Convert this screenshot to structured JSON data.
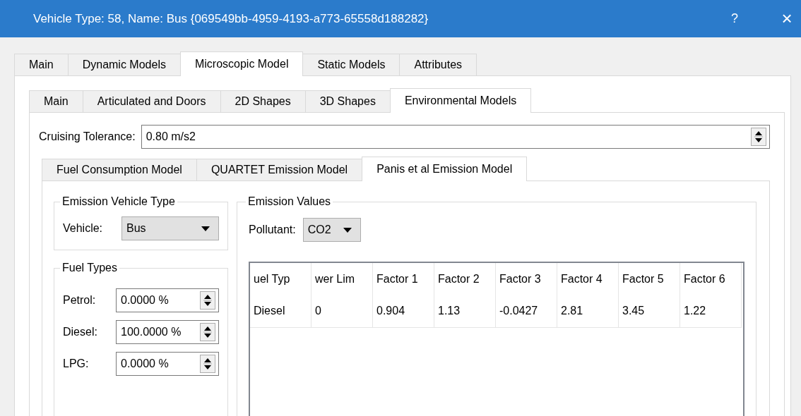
{
  "window": {
    "title": "Vehicle Type: 58, Name: Bus {069549bb-4959-4193-a773-65558d188282}",
    "help_button": "?",
    "close_button": "×"
  },
  "tabs": [
    {
      "label": "Main",
      "selected": false
    },
    {
      "label": "Dynamic Models",
      "selected": false
    },
    {
      "label": "Microscopic Model",
      "selected": true
    },
    {
      "label": "Static Models",
      "selected": false
    },
    {
      "label": "Attributes",
      "selected": false
    }
  ],
  "subtabs": [
    {
      "label": "Main",
      "selected": false
    },
    {
      "label": "Articulated and Doors",
      "selected": false
    },
    {
      "label": "2D Shapes",
      "selected": false
    },
    {
      "label": "3D Shapes",
      "selected": false
    },
    {
      "label": "Environmental Models",
      "selected": true
    }
  ],
  "cruising_tolerance": {
    "label": "Cruising Tolerance:",
    "value": "0.80 m/s2"
  },
  "model_tabs": [
    {
      "label": "Fuel Consumption Model",
      "selected": false
    },
    {
      "label": "QUARTET Emission Model",
      "selected": false
    },
    {
      "label": "Panis et al Emission Model",
      "selected": true
    }
  ],
  "emission_vehicle_type": {
    "title": "Emission Vehicle Type",
    "vehicle": {
      "label": "Vehicle:",
      "value": "Bus"
    }
  },
  "fuel_types": {
    "title": "Fuel Types",
    "fields": [
      {
        "label": "Petrol:",
        "value": "0.0000 %"
      },
      {
        "label": "Diesel:",
        "value": "100.0000 %"
      },
      {
        "label": "LPG:",
        "value": "0.0000 %"
      }
    ]
  },
  "emission_values": {
    "title": "Emission Values",
    "pollutant": {
      "label": "Pollutant:",
      "value": "CO2"
    },
    "table": {
      "columns": [
        "uel Typ",
        "wer Lim",
        "Factor 1",
        "Factor 2",
        "Factor 3",
        "Factor 4",
        "Factor 5",
        "Factor 6"
      ],
      "rows": [
        [
          "Diesel",
          "0",
          "0.904",
          "1.13",
          "-0.0427",
          "2.81",
          "3.45",
          "1.22"
        ]
      ]
    }
  }
}
